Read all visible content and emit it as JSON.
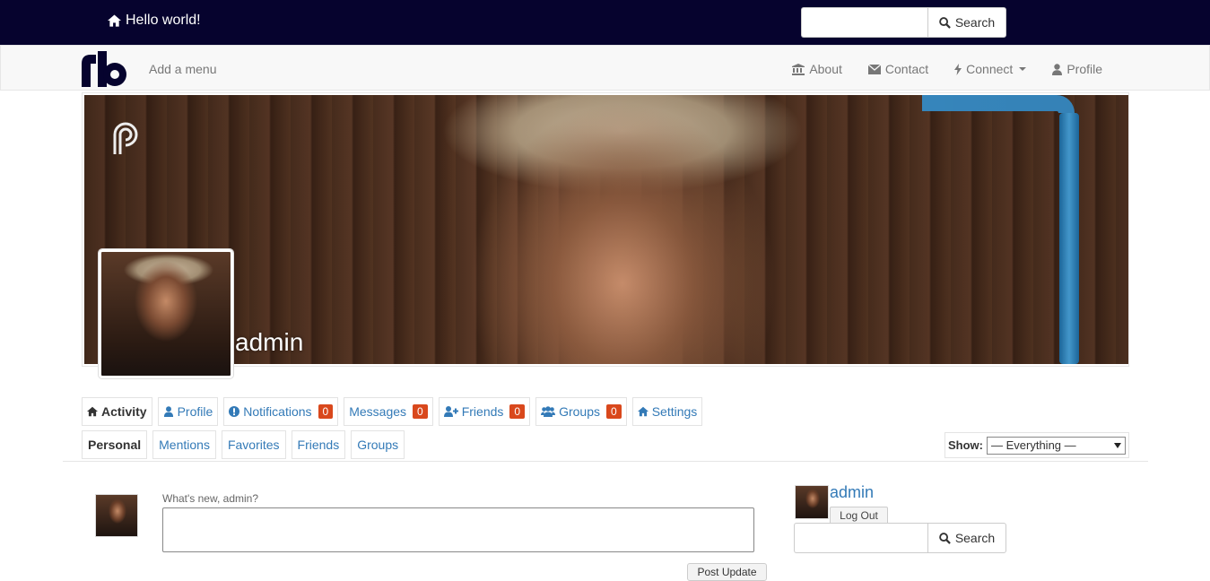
{
  "topbar": {
    "home_label": "Hello world!",
    "search_button": "Search",
    "search_value": ""
  },
  "navbar": {
    "add_menu": "Add a menu",
    "links": [
      {
        "label": "About",
        "icon": "bank-icon"
      },
      {
        "label": "Contact",
        "icon": "envelope-icon"
      },
      {
        "label": "Connect",
        "icon": "bolt-icon"
      },
      {
        "label": "Profile",
        "icon": "user-icon"
      }
    ]
  },
  "profile": {
    "name": "admin"
  },
  "tabs": [
    {
      "label": "Activity",
      "icon": "home-icon"
    },
    {
      "label": "Profile",
      "icon": "user-icon"
    },
    {
      "label": "Notifications",
      "icon": "exclamation-icon",
      "count": "0"
    },
    {
      "label": "Messages",
      "count": "0"
    },
    {
      "label": "Friends",
      "icon": "user-plus-icon",
      "count": "0"
    },
    {
      "label": "Groups",
      "icon": "users-icon",
      "count": "0"
    },
    {
      "label": "Settings",
      "icon": "home-icon"
    }
  ],
  "subtabs": [
    "Personal",
    "Mentions",
    "Favorites",
    "Friends",
    "Groups"
  ],
  "filter": {
    "label": "Show:",
    "selected": "— Everything —"
  },
  "post": {
    "prompt": "What's new, admin?",
    "button": "Post Update"
  },
  "sidebar": {
    "name": "admin",
    "logout": "Log Out",
    "search_button": "Search"
  },
  "colors": {
    "topbar": "#06032e",
    "link": "#337ab7",
    "badge": "#d9481c"
  }
}
